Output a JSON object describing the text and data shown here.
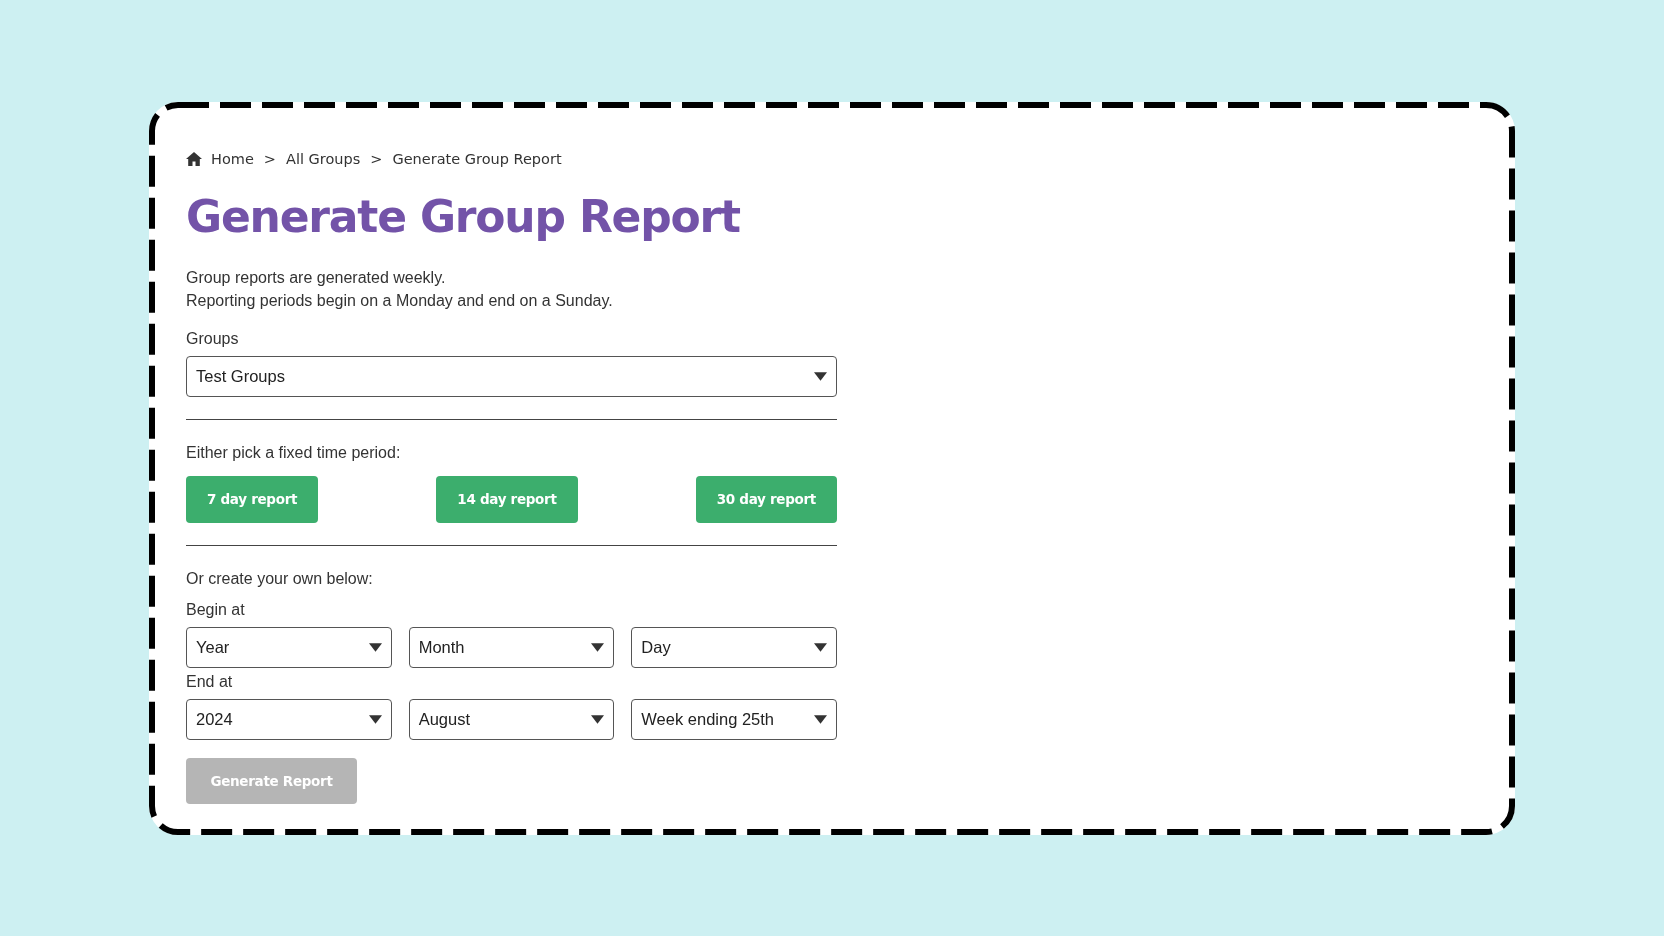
{
  "breadcrumb": {
    "items": [
      {
        "label": "Home"
      },
      {
        "label": "All Groups"
      },
      {
        "label": "Generate Group Report"
      }
    ],
    "separators": [
      ">",
      ">"
    ]
  },
  "title": "Generate Group Report",
  "intro": [
    "Group reports are generated weekly.",
    "Reporting periods begin on a Monday and end on a Sunday."
  ],
  "groups": {
    "label": "Groups",
    "value": "Test Groups"
  },
  "fixed_period": {
    "prompt": "Either pick a fixed time period:",
    "buttons": [
      "7 day report",
      "14 day report",
      "30 day report"
    ]
  },
  "custom_period": {
    "prompt": "Or create your own below:",
    "ranges": [
      {
        "label": "Begin at",
        "fields": [
          {
            "value": "Year"
          },
          {
            "value": "Month"
          },
          {
            "value": "Day"
          }
        ]
      },
      {
        "label": "End at",
        "fields": [
          {
            "value": "2024"
          },
          {
            "value": "August"
          },
          {
            "value": "Week ending 25th"
          }
        ]
      }
    ]
  },
  "generate_button": {
    "label": "Generate Report",
    "disabled": true
  }
}
